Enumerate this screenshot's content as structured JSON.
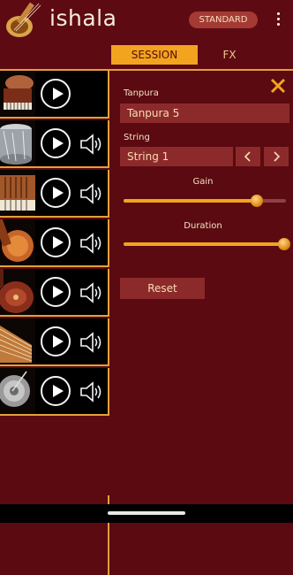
{
  "app": {
    "brand": "ishala",
    "mode_label": "STANDARD"
  },
  "tabs": [
    {
      "label": "SESSION",
      "active": true
    },
    {
      "label": "FX",
      "active": false
    }
  ],
  "instruments": [
    {
      "kind": "harmonium-drum",
      "has_speaker": false
    },
    {
      "kind": "drum",
      "has_speaker": true
    },
    {
      "kind": "harmonium",
      "has_speaker": true
    },
    {
      "kind": "tanpura",
      "has_speaker": true
    },
    {
      "kind": "sitar",
      "has_speaker": true
    },
    {
      "kind": "swarmandal",
      "has_speaker": true
    },
    {
      "kind": "manjira",
      "has_speaker": true
    }
  ],
  "panel": {
    "tanpura_label": "Tanpura",
    "tanpura_value": "Tanpura 5",
    "string_label": "String",
    "string_value": "String 1",
    "gain_label": "Gain",
    "gain_value": 0.82,
    "duration_label": "Duration",
    "duration_value": 1.0,
    "reset_label": "Reset"
  },
  "colors": {
    "accent": "#f2a41e",
    "background": "#5a0a10",
    "field": "#8c2a2b"
  },
  "icons": [
    "tanpura-logo-icon",
    "more-vert-icon",
    "play-icon",
    "speaker-icon",
    "close-icon",
    "chevron-left-icon",
    "chevron-right-icon"
  ]
}
